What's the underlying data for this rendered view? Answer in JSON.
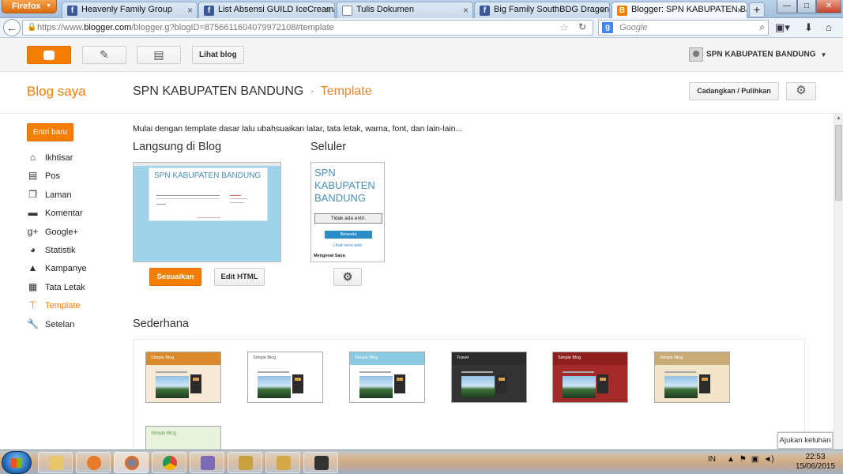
{
  "browser": {
    "menu_label": "Firefox",
    "tabs": [
      {
        "label": "Heavenly Family Group",
        "favicon": "facebook-icon"
      },
      {
        "label": "List Absensi GUILD IceCream/La...",
        "favicon": "facebook-icon"
      },
      {
        "label": "Tulis Dokumen",
        "favicon": "document-icon"
      },
      {
        "label": "Big Family SouthBDG Dragon N...",
        "favicon": "facebook-icon"
      },
      {
        "label": "Blogger: SPN KABUPATEN BAN...",
        "favicon": "blogger-icon",
        "active": true
      }
    ],
    "url_prefix": "https://www.",
    "url_domain": "blogger.com",
    "url_path": "/blogger.g?blogID=8756611604079972108#template",
    "search_placeholder": "Google"
  },
  "header": {
    "view_blog_label": "Lihat blog",
    "user_name": "SPN KABUPATEN BANDUNG"
  },
  "titlebar": {
    "my_blogs": "Blog saya",
    "blog_name": "SPN KABUPATEN BANDUNG",
    "separator": "·",
    "current_page": "Template",
    "backup_label": "Cadangkan / Pulihkan"
  },
  "sidebar": {
    "new_post_label": "Entri baru",
    "items": [
      {
        "label": "Ikhtisar",
        "icon": "home-icon"
      },
      {
        "label": "Pos",
        "icon": "posts-icon"
      },
      {
        "label": "Laman",
        "icon": "pages-icon"
      },
      {
        "label": "Komentar",
        "icon": "comment-icon"
      },
      {
        "label": "Google+",
        "icon": "google-plus-icon"
      },
      {
        "label": "Statistik",
        "icon": "stats-icon"
      },
      {
        "label": "Kampanye",
        "icon": "campaign-icon"
      },
      {
        "label": "Tata Letak",
        "icon": "layout-icon"
      },
      {
        "label": "Template",
        "icon": "template-icon",
        "active": true
      },
      {
        "label": "Setelan",
        "icon": "wrench-icon"
      }
    ]
  },
  "main": {
    "intro": "Mulai dengan template dasar lalu ubahsuaikan latar, tata letak, warna, font, dan lain-lain...",
    "live_heading": "Langsung di Blog",
    "mobile_heading": "Seluler",
    "live_preview_title": "SPN KABUPATEN BANDUNG",
    "mobile_preview": {
      "title": "SPN KABUPATEN BANDUNG",
      "no_posts": "Tidak ada entri.",
      "home": "Beranda",
      "web_version": "Lihat versi web",
      "powered": "Mengenai Saya"
    },
    "customize_label": "Sesuaikan",
    "edit_html_label": "Edit HTML",
    "simple_heading": "Sederhana",
    "gallery": [
      {
        "label": "Simple Blog",
        "header_color": "#d98a2b",
        "body_color": "#f6ead7"
      },
      {
        "label": "Simple Blog",
        "header_color": "#ffffff",
        "body_color": "#ffffff"
      },
      {
        "label": "Simple Blog",
        "header_color": "#8cc9e3",
        "body_color": "#ffffff"
      },
      {
        "label": "Travel",
        "header_color": "#2b2b2b",
        "body_color": "#333333"
      },
      {
        "label": "Simple Blog",
        "header_color": "#8f1e1e",
        "body_color": "#a52a2a"
      },
      {
        "label": "Simple Blog",
        "header_color": "#c9ab78",
        "body_color": "#f1e4c9"
      }
    ],
    "gallery_partial_label": "Simple Blog"
  },
  "feedback_label": "Ajukan keluhan",
  "taskbar": {
    "language": "IN",
    "time": "22:53",
    "date": "15/06/2015"
  },
  "colors": {
    "accent": "#f57d00"
  }
}
